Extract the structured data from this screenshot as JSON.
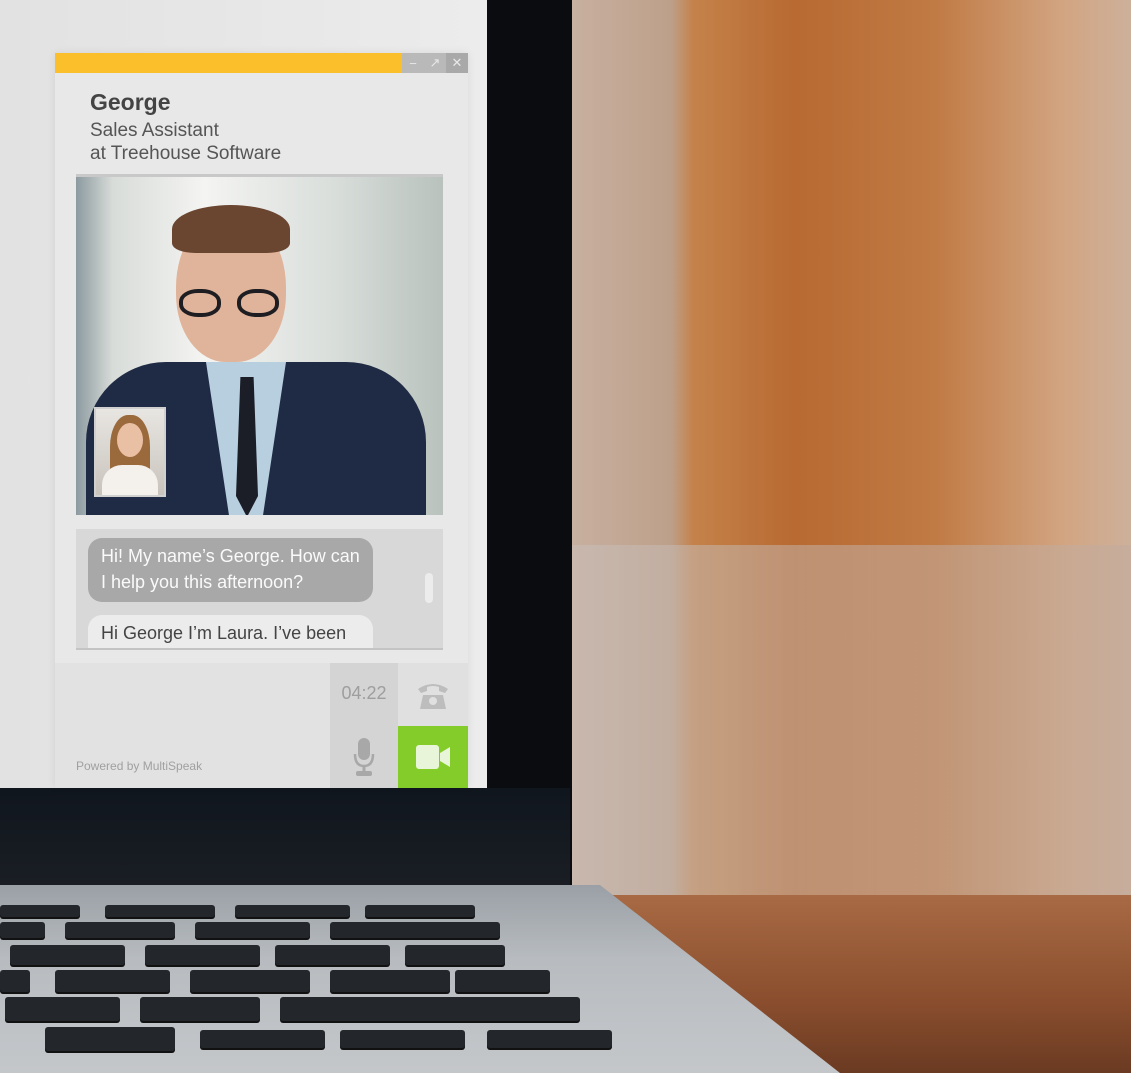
{
  "widget": {
    "window_controls": {
      "minimize": "−",
      "expand": "↗",
      "close": "✕"
    },
    "accent_color": "#fbbf2c",
    "agent": {
      "name": "George",
      "role_line1": "Sales Assistant",
      "role_line2": "at Treehouse Software"
    },
    "chat": {
      "messages": [
        {
          "from": "agent",
          "text": "Hi! My name’s George. How can I help you this afternoon?"
        },
        {
          "from": "user",
          "text": "Hi George I’m Laura. I’ve been"
        }
      ]
    },
    "footer": {
      "powered_by": "Powered by MultiSpeak",
      "call_timer": "04:22",
      "icons": {
        "phone": "phone-icon",
        "mic": "microphone-icon",
        "video": "video-camera-icon"
      },
      "video_button_color": "#84cc2a"
    }
  }
}
